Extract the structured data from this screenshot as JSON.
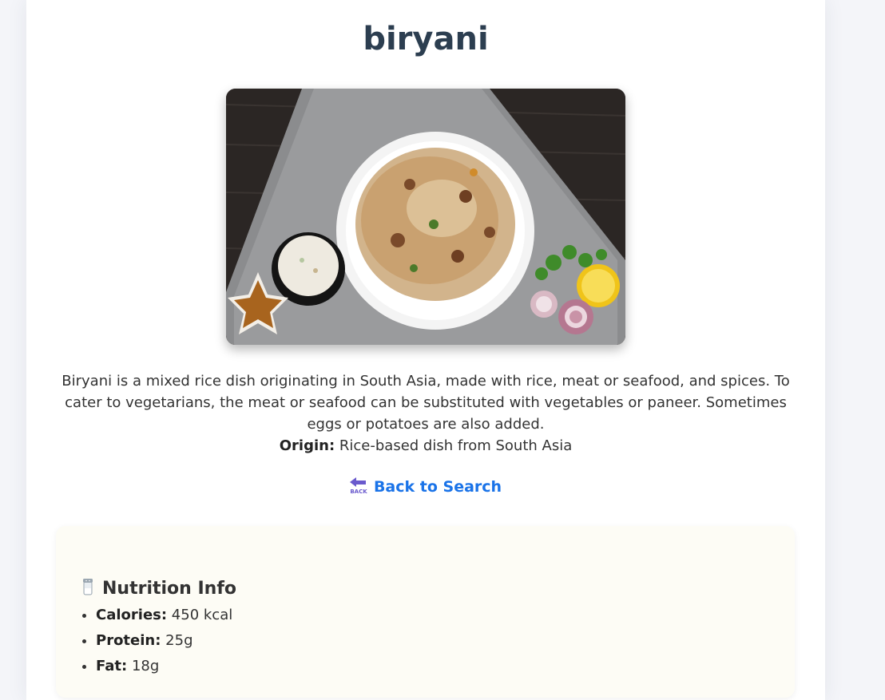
{
  "recipe": {
    "title": "biryani",
    "image_alt": "biryani",
    "description": "Biryani is a mixed rice dish originating in South Asia, made with rice, meat or seafood, and spices. To cater to vegetarians, the meat or seafood can be substituted with vegetables or paneer. Sometimes eggs or potatoes are also added.",
    "origin_label": "Origin:",
    "origin_value": "Rice-based dish from South Asia"
  },
  "nav": {
    "back_icon": "back-arrow-icon",
    "back_label": "Back to Search"
  },
  "nutrition": {
    "icon": "salt-shaker-icon",
    "heading": "Nutrition Info",
    "items": [
      {
        "label": "Calories:",
        "value": "450 kcal"
      },
      {
        "label": "Protein:",
        "value": "25g"
      },
      {
        "label": "Fat:",
        "value": "18g"
      }
    ]
  },
  "colors": {
    "title": "#2c3e50",
    "link": "#1a73e8",
    "card_bg": "#fdfcf5",
    "page_bg": "#f4f5f9"
  }
}
